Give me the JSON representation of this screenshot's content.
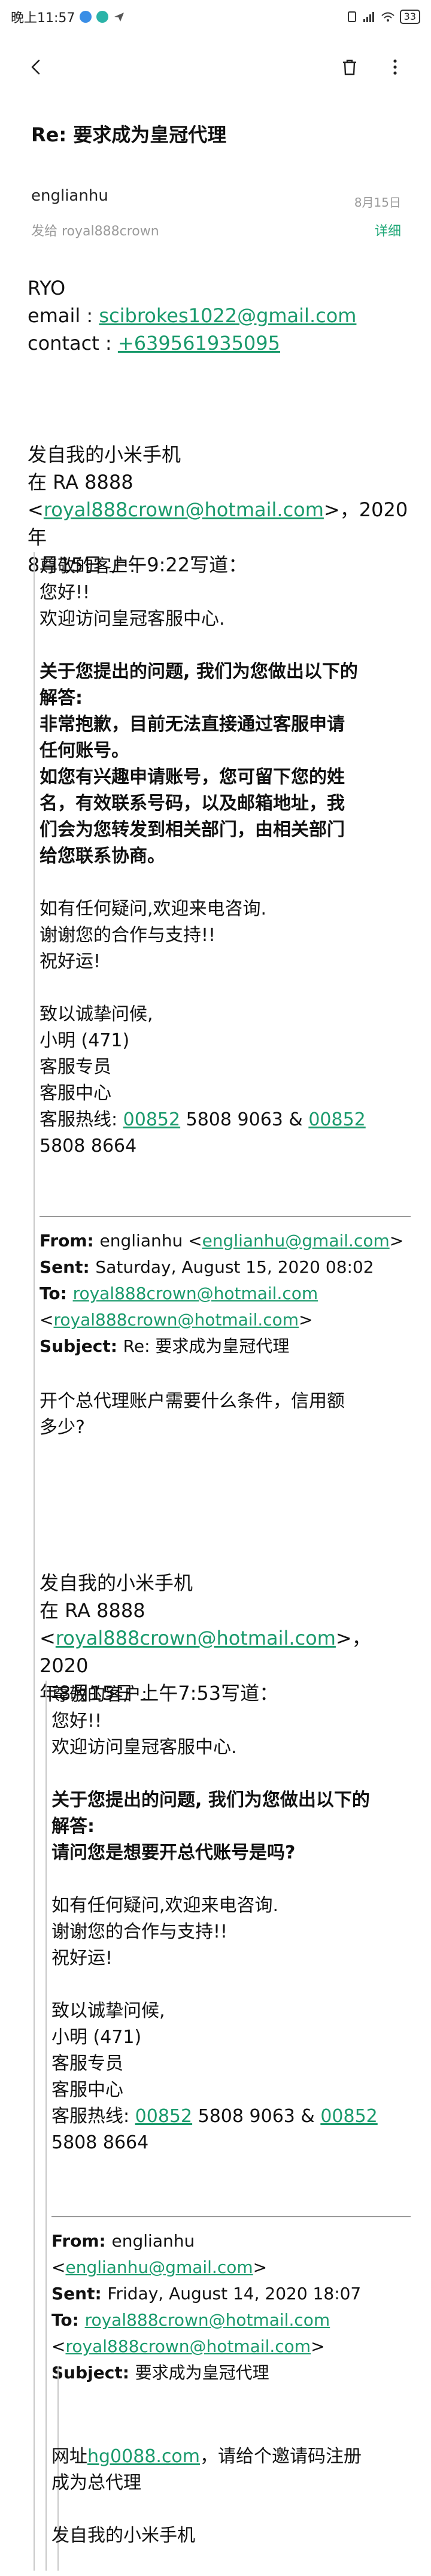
{
  "status_bar": {
    "time": "晚上11:57",
    "battery": "33"
  },
  "toolbar": {
    "back_icon": "back-arrow-icon",
    "delete_icon": "trash-icon",
    "more_icon": "more-vertical-icon"
  },
  "email": {
    "subject": "Re: 要求成为皇冠代理",
    "sender": "englianhu",
    "date": "8月15日",
    "recipient": "发给 royal888crown",
    "details_label": "详细"
  },
  "body": {
    "name": "RYO",
    "email_label": "email : ",
    "email_value": "scibrokes1022@gmail.com",
    "contact_label": "contact : ",
    "contact_value": "+639561935095"
  },
  "quote1": {
    "line1": "发自我的小米手机",
    "line2": "在 RA 8888",
    "line3_pre": "<",
    "line3_link": "royal888crown@hotmail.com",
    "line3_post": ">，2020年",
    "line4": "8月15日 上午9:22写道：",
    "greet1": "尊敬的客户:",
    "greet2": "您好!!",
    "greet3": "欢迎访问皇冠客服中心.",
    "bold1": "关于您提出的问题, 我们为您做出以下的",
    "bold2": "解答:",
    "bold3": "非常抱歉，目前无法直接通过客服申请",
    "bold4": "任何账号。",
    "bold5": "如您有兴趣申请账号，您可留下您的姓",
    "bold6": "名，有效联系号码，以及邮箱地址，我",
    "bold7": "们会为您转发到相关部门，由相关部门",
    "bold8": "给您联系协商。",
    "closing1": "如有任何疑问,欢迎来电咨询.",
    "closing2": "谢谢您的合作与支持!!",
    "closing3": "祝好运!",
    "sig1": "致以诚挚问候,",
    "sig2": "小明 (471)",
    "sig3": "客服专员",
    "sig4": "客服中心",
    "hotline_label": "客服热线: ",
    "hotline_link1": "00852",
    "hotline_mid": " 5808 9063 & ",
    "hotline_link2": "00852",
    "hotline_end": "5808 8664"
  },
  "header1": {
    "from_label": "From: ",
    "from_name": "englianhu <",
    "from_email": "englianhu@gmail.com",
    "from_end": ">",
    "sent_label": "Sent: ",
    "sent_value": "Saturday, August 15, 2020 08:02",
    "to_label": "To: ",
    "to_email1": "royal888crown@hotmail.com",
    "to_lt": "<",
    "to_email2": "royal888crown@hotmail.com",
    "to_gt": ">",
    "subject_label": "Subject: ",
    "subject_value": "Re: 要求成为皇冠代理",
    "message1": "开个总代理账户需要什么条件，信用额",
    "message2": "多少?"
  },
  "quote2": {
    "line1": "发自我的小米手机",
    "line2": "在 RA 8888",
    "line3_pre": "<",
    "line3_link": "royal888crown@hotmail.com",
    "line3_post": ">，2020",
    "line4": "年8月15日 上午7:53写道：",
    "greet1": "尊敬的客户:",
    "greet2": "您好!!",
    "greet3": "欢迎访问皇冠客服中心.",
    "bold1": "关于您提出的问题, 我们为您做出以下的",
    "bold2": "解答:",
    "bold3": "请问您是想要开总代账号是吗?",
    "closing1": "如有任何疑问,欢迎来电咨询.",
    "closing2": "谢谢您的合作与支持!!",
    "closing3": "祝好运!",
    "sig1": "致以诚挚问候,",
    "sig2": "小明 (471)",
    "sig3": "客服专员",
    "sig4": "客服中心",
    "hotline_label": "客服热线: ",
    "hotline_link1": "00852",
    "hotline_mid": " 5808 9063 & ",
    "hotline_link2": "00852",
    "hotline_end": "5808 8664"
  },
  "header2": {
    "from_label": "From: ",
    "from_name": "englianhu <",
    "from_email": "englianhu@gmail.com",
    "from_end": ">",
    "sent_label": "Sent: ",
    "sent_value": "Friday, August 14, 2020 18:07",
    "to_label": "To: ",
    "to_email1": "royal888crown@hotmail.com",
    "to_lt": "<",
    "to_email2": "royal888crown@hotmail.com",
    "to_gt": ">",
    "subject_label": "Subject: ",
    "subject_value": "要求成为皇冠代理",
    "message_pre": "网址",
    "message_link": "hg0088.com",
    "message_post": "，请给个邀请码注册",
    "message2": "成为总代理",
    "trailing": "发自我的小米手机"
  },
  "colors": {
    "link": "#1a9a6c",
    "details": "#20a878",
    "muted": "#9a9a9a"
  }
}
